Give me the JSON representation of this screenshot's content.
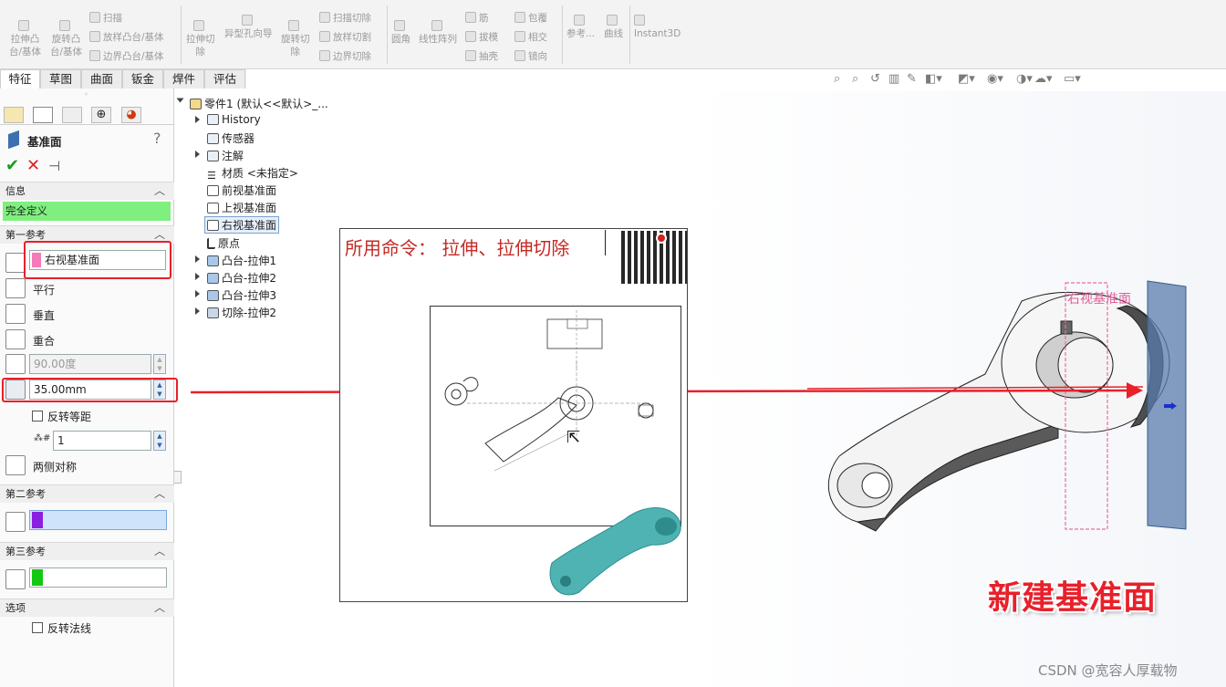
{
  "ribbon": {
    "extrude_boss": "拉伸凸",
    "extrude_boss2": "台/基体",
    "revolve_boss": "旋转凸",
    "revolve_boss2": "台/基体",
    "sweep": "扫描",
    "loft_boss": "放样凸台/基体",
    "boundary_boss": "边界凸台/基体",
    "extrude_cut": "拉伸切",
    "extrude_cut2": "除",
    "hole_wizard": "异型孔向导",
    "revolve_cut": "旋转切",
    "revolve_cut2": "除",
    "swept_cut": "扫描切除",
    "lofted_cut": "放样切割",
    "boundary_cut": "边界切除",
    "fillet": "圆角",
    "linear_pattern": "线性阵列",
    "rib": "筋",
    "draft": "拔模",
    "shell": "抽壳",
    "wrap": "包覆",
    "intersect": "相交",
    "mirror": "镜向",
    "reference": "参考...",
    "curves": "曲线",
    "instant3d": "Instant3D"
  },
  "tabs": [
    "特征",
    "草图",
    "曲面",
    "钣金",
    "焊件",
    "评估"
  ],
  "pm": {
    "title": "基准面",
    "help": "?",
    "sections": {
      "info": "信息",
      "first_ref": "第一参考",
      "second_ref": "第二参考",
      "third_ref": "第三参考",
      "options": "选项"
    },
    "info_status": "完全定义",
    "first_ref_value": "右视基准面",
    "parallel": "平行",
    "perpendicular": "垂直",
    "coincident": "重合",
    "angle_value": "90.00度",
    "distance_value": "35.00mm",
    "flip_offset": "反转等距",
    "instances_value": "1",
    "mid_plane": "两侧对称",
    "flip_normal": "反转法线",
    "colors": {
      "first": "#f47ab8",
      "second": "#8a1fe0",
      "third": "#12c812",
      "info_bg": "#7ff07f"
    }
  },
  "tree": {
    "root": "零件1  (默认<<默认>_...",
    "items": [
      "History",
      "传感器",
      "注解",
      "材质 <未指定>",
      "前视基准面",
      "上视基准面",
      "右视基准面",
      "原点",
      "凸台-拉伸1",
      "凸台-拉伸2",
      "凸台-拉伸3",
      "切除-拉伸2"
    ]
  },
  "inset": {
    "caption": "所用命令：   拉伸、拉伸切除"
  },
  "viewport": {
    "plane_label": "右视基准面",
    "overlay_title": "新建基准面",
    "watermark": "CSDN @宽容人厚载物"
  }
}
